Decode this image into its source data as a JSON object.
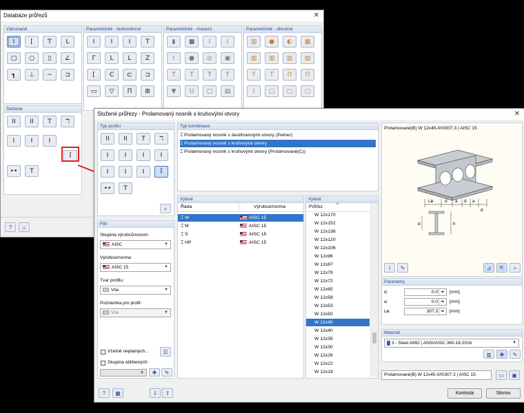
{
  "back_window": {
    "title": "Databáze průřezů",
    "groups": {
      "valcovane": "Válcované",
      "param_tenkostenne": "Parametrické - tenkostěnné",
      "param_masivni": "Parametrické - masivní",
      "param_drevene": "Parametrické - dřevěné",
      "slozene": "Složené"
    }
  },
  "front_window": {
    "title": "Složené průřezy - Prolamovaný nosník s kruhovými otvory",
    "typ_profilu": {
      "header": "Typ profilu"
    },
    "typ_kombinace": {
      "header": "Typ kombinace",
      "items": [
        "Prolamovaný nosník s šestihrannými otvory (Peiner)",
        "Prolamovaný nosník s kruhovými otvory",
        "Prolamovaný nosník s kruhovými otvory (Prolamované(C))"
      ],
      "selected_index": 1
    },
    "filtr": {
      "header": "Filtr",
      "skupina_label": "Skupina výrobců/norem:",
      "skupina_value": "AISC",
      "vyrobce_label": "Výrobce/norma:",
      "vyrobce_value": "AISC 15",
      "tvar_label": "Tvar profilu:",
      "tvar_value": "Vše",
      "poznamka_label": "Poznámka pro profil:",
      "poznamka_value": "Vše",
      "vcetne_label": "Včetně neplatných...",
      "oblibenych_label": "Skupina oblíbených:"
    },
    "vybrat_rada": {
      "header": "Vybrat",
      "col_rada": "Řada",
      "col_norma": "Výrobce/norma",
      "rows": [
        {
          "rada": "W",
          "norma": "AISC 15",
          "selected": true
        },
        {
          "rada": "M",
          "norma": "AISC 15",
          "selected": false
        },
        {
          "rada": "S",
          "norma": "AISC 15",
          "selected": false
        },
        {
          "rada": "HP",
          "norma": "AISC 15",
          "selected": false
        }
      ]
    },
    "vybrat_prurez": {
      "header": "Vybrat",
      "col": "Průřez",
      "items": [
        "W 12x170",
        "W 12x152",
        "W 12x136",
        "W 12x120",
        "W 12x106",
        "W 12x96",
        "W 12x87",
        "W 12x79",
        "W 12x72",
        "W 12x65",
        "W 12x58",
        "W 12x53",
        "W 12x50",
        "W 12x45",
        "W 12x40",
        "W 12x35",
        "W 12x30",
        "W 12x26",
        "W 12x22",
        "W 12x19"
      ],
      "selected": "W 12x45"
    },
    "preview": {
      "title": "Prolamované(B) W 12x45-0/0/307.3 | AISC 15",
      "dim_labels": [
        "Lᴃ",
        "d",
        "a",
        "d",
        "a",
        "d",
        "h"
      ]
    },
    "parametry": {
      "header": "Parametry",
      "rows": [
        {
          "label": "d:",
          "value": "0.0",
          "unit": "[mm]"
        },
        {
          "label": "a:",
          "value": "0.0",
          "unit": "[mm]"
        },
        {
          "label": "Lᴃ:",
          "value": "307.3",
          "unit": "[mm]"
        }
      ]
    },
    "material": {
      "header": "Materiál",
      "value": "3 - Steel A992 | ANSI/AISC 360-16:2016"
    },
    "result_name": "Prolamované(B) W 12x45-0/0/307.3 | AISC 15",
    "buttons": {
      "kontrola": "Kontrola",
      "storno": "Storno"
    }
  },
  "colors": {
    "selection": "#3275c8",
    "header_text": "#1d4a85",
    "arrow": "#e02020",
    "highlight_box": "#e02020"
  }
}
